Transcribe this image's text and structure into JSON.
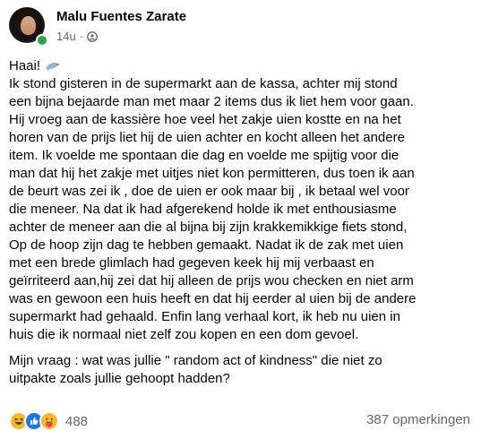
{
  "post": {
    "author": "Malu Fuentes Zarate",
    "time": "14u",
    "separator": "·",
    "audience_icon": "globe-icon",
    "greeting": "Haai!",
    "greeting_icon": "dolphin-icon",
    "paragraph1_lines": [
      "Ik stond gisteren in de supermarkt aan de kassa, achter mij stond",
      "een bijna bejaarde man met maar 2 items dus ik liet hem voor gaan.",
      "Hij vroeg aan de kassière hoe veel het zakje uien kostte en na het",
      "horen van de prijs liet hij de uien achter en kocht alleen het andere",
      "item. Ik voelde me spontaan die dag en voelde me spijtig voor die",
      "man dat hij het zakje met uitjes niet kon permitteren, dus toen ik aan",
      "de beurt was zei ik , doe de uien er ook maar bij , ik betaal wel voor",
      "die meneer. Na dat ik had afgerekend holde ik met enthousiasme",
      "achter de meneer aan die al bijna bij zijn krakkemikkige fiets stond,",
      "Op de hoop zijn dag te hebben gemaakt.  Nadat ik de zak met uien",
      "met een brede glimlach had gegeven keek hij mij verbaast  en",
      "geïrriteerd aan,hij zei dat hij alleen de prijs wou checken en niet arm",
      "was en gewoon een huis heeft en dat hij eerder al uien bij de andere",
      "supermarkt had gehaald. Enfin lang verhaal kort, ik heb nu uien in",
      "huis die ik normaal niet zelf zou kopen en een dom gevoel."
    ],
    "paragraph2_lines": [
      "Mijn vraag : wat was jullie \" random act of kindness\" die niet zo",
      "uitpakte zoals jullie gehoopt hadden?"
    ]
  },
  "footer": {
    "reaction_icons": [
      "haha-icon",
      "like-icon",
      "care-icon"
    ],
    "reaction_count": "488",
    "comments_label": "387 opmerkingen"
  },
  "colors": {
    "text": "#050505",
    "secondary": "#65676b",
    "online": "#31a24c",
    "like_blue": "#1877f2",
    "reaction_yellow": "#f7b928"
  }
}
